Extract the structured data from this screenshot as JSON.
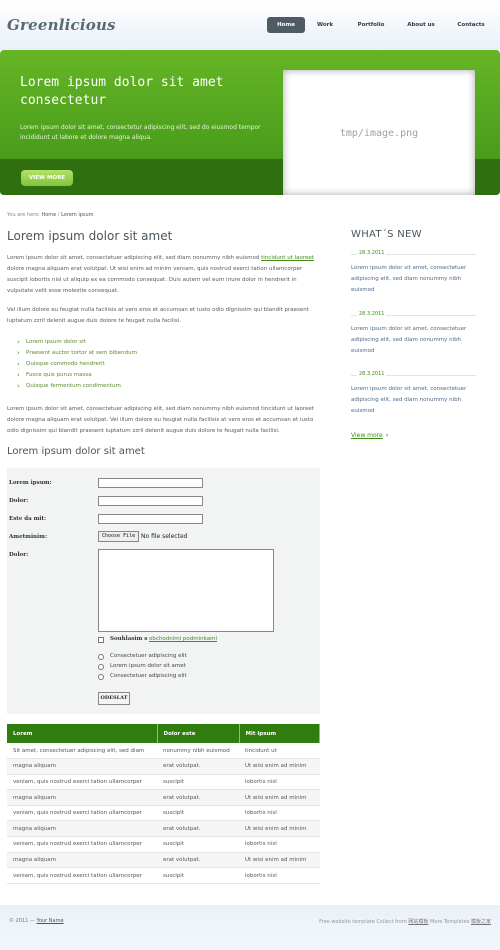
{
  "logo": "Greenlicious",
  "nav": {
    "items": [
      {
        "label": "Home",
        "active": true
      },
      {
        "label": "Work",
        "active": false
      },
      {
        "label": "Portfolio",
        "active": false
      },
      {
        "label": "About us",
        "active": false
      },
      {
        "label": "Contacts",
        "active": false
      }
    ]
  },
  "hero": {
    "title": "Lorem ipsum dolor sit amet consectetur",
    "text": "Lorem ipsum dolor sit amet, consectetur adipiscing elit, sed do eiusmod tempor incididunt ut labore et dolore magna aliqua.",
    "button": "VIEW MORE",
    "image_placeholder": "tmp/image.png"
  },
  "breadcrumb": {
    "prefix": "You are here:",
    "home": "Home",
    "separator": "/",
    "current": "Lorem ipsum"
  },
  "main": {
    "title": "Lorem ipsum dolor sit amet",
    "para1_a": "Lorem ipsum dolor sit amet, consectetuer adipiscing elit, sed diam nonummy nibh euismod ",
    "para1_link": "tincidunt ut laoreet",
    "para1_b": " dolore magna aliquam erat volutpat. Ut wisi enim ad minim veniam, quis nostrud exerci tation ullamcorper suscipit lobortis nisl ut aliquip ex ea commodo consequat. Duis autem vel eum iriure dolor in hendrerit in vulputate velit esse molestie consequat.",
    "para2": "Vel illum dolore eu feugiat nulla facilisis at vero eros et accumsan et iusto odio dignissim qui blandit praesent luptatum zzril delenit augue duis dolore te feugait nulla facilisi.",
    "list": [
      "Lorem ipsum dolor sit",
      "Praesent auctor tortor at sem bibendum",
      "Quisque commodo hendrerit",
      "Fusce quis purus massa",
      "Quisque fermentum condimentum"
    ],
    "para3": "Lorem ipsum dolor sit amet, consectetuer adipiscing elit, sed diam nonummy nibh euismod tincidunt ut laoreet dolore magna aliquam erat volutpat. Vel illum dolore eu feugiat nulla facilisis at vero eros et accumsan et iusto odio dignissim qui blandit praesent luptatum zzril delenit augue duis dolore te feugait nulla facilisi.",
    "form_title": "Lorem ipsum dolor sit amet"
  },
  "form": {
    "label_name": "Lorem ipsum:",
    "label_dolor": "Dolor:",
    "label_email": "Este da mit:",
    "label_file": "Ametminim:",
    "file_button": "Choose File",
    "file_status": "No file selected",
    "label_message": "Dolor:",
    "checkbox_bold": "Souhlasim s",
    "checkbox_link": "obchodnimi podminkami",
    "radios": [
      "Consectetuer adipiscing elit",
      "Lorem ipsum dolor sit amet",
      "Consectetuer adipiscing elit"
    ],
    "submit": "ODESLAT"
  },
  "table": {
    "headers": [
      "Lorem",
      "Dolor este",
      "Mit ipsum"
    ],
    "rows": [
      [
        "Sit amet, consectetuer adipiscing elit, sed diam",
        "nonummy nibh euismod",
        "tincidunt ut"
      ],
      [
        "magna aliquam",
        "erat volutpat.",
        "Ut wisi enim ad minim"
      ],
      [
        "veniam, quis nostrud exerci tation ullamcorper",
        "suscipit",
        "lobortis nisl"
      ],
      [
        "magna aliquam",
        "erat volutpat.",
        "Ut wisi enim ad minim"
      ],
      [
        "veniam, quis nostrud exerci tation ullamcorper",
        "suscipit",
        "lobortis nisl"
      ],
      [
        "magna aliquam",
        "erat volutpat.",
        "Ut wisi enim ad minim"
      ],
      [
        "veniam, quis nostrud exerci tation ullamcorper",
        "suscipit",
        "lobortis nisl"
      ],
      [
        "magna aliquam",
        "erat volutpat.",
        "Ut wisi enim ad minim"
      ],
      [
        "veniam, quis nostrud exerci tation ullamcorper",
        "suscipit",
        "lobortis nisl"
      ]
    ]
  },
  "sidebar": {
    "title": "WHAT´S NEW",
    "news": [
      {
        "date": "28.3.2011",
        "text": "Lorem ipsum dolor sit amet, consectetuer adipiscing elit, sed diam nonummy nibh euismod"
      },
      {
        "date": "28.3.2011",
        "text": "Lorem ipsum dolor sit amet, consectetuer adipiscing elit, sed diam nonummy nibh euismod"
      },
      {
        "date": "28.3.2011",
        "text": "Lorem ipsum dolor sit amet, consectetuer adipiscing elit, sed diam nonummy nibh euismod"
      }
    ],
    "view_more": "View more"
  },
  "footer": {
    "copyright": "© 2011 —",
    "name_link": "Your Name",
    "right_text": "Free website template Collect from",
    "right_link1": "网站模板",
    "right_text2": "More Templates",
    "right_link2": "模板之家"
  },
  "colors": {
    "accent_green": "#3d8d17",
    "hero_green": "#5aaa22",
    "nav_active": "#4e5b63"
  }
}
